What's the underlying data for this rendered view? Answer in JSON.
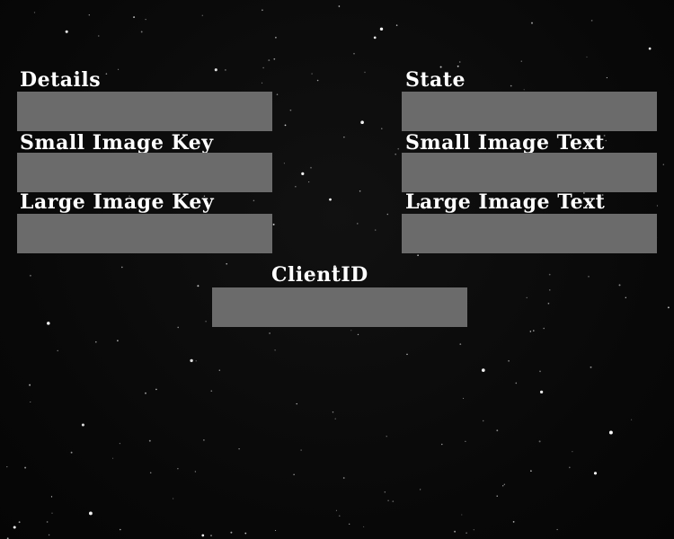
{
  "fields": {
    "details": {
      "label": "Details",
      "value": ""
    },
    "state": {
      "label": "State",
      "value": ""
    },
    "small_image_key": {
      "label": "Small Image Key",
      "value": ""
    },
    "small_image_text": {
      "label": "Small Image Text",
      "value": ""
    },
    "large_image_key": {
      "label": "Large Image Key",
      "value": ""
    },
    "large_image_text": {
      "label": "Large Image Text",
      "value": ""
    },
    "client_id": {
      "label": "ClientID",
      "value": ""
    }
  },
  "colors": {
    "background": "#0a0a0a",
    "input_fill": "#6b6b6b",
    "label_text": "#ffffff",
    "star": "#ffffff"
  }
}
